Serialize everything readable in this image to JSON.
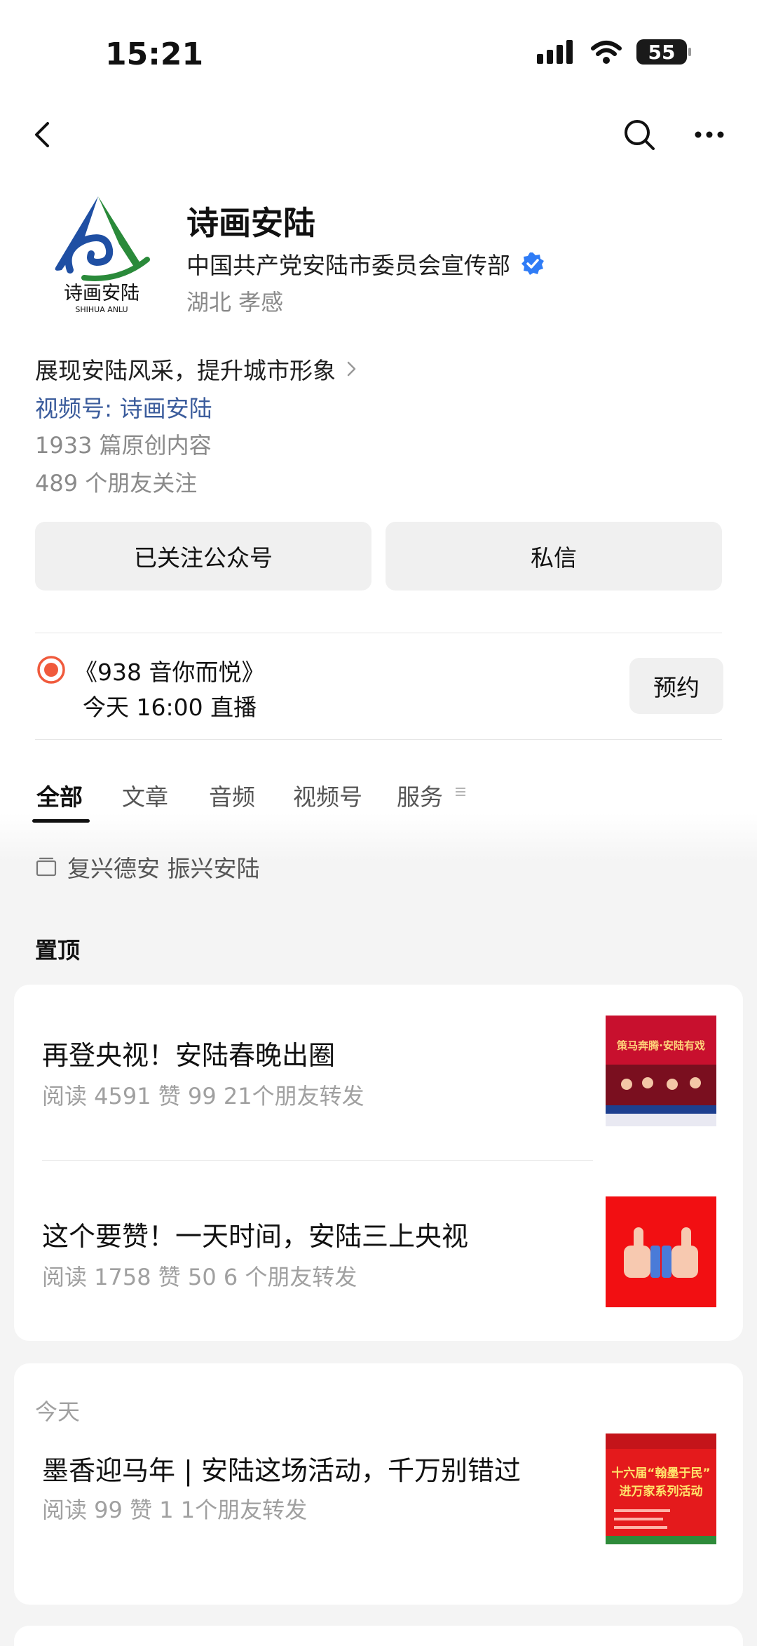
{
  "status": {
    "time": "15:21",
    "battery": "55"
  },
  "profile": {
    "name": "诗画安陆",
    "logo_text": "诗画安陆",
    "logo_subtext": "SHIHUA ANLU",
    "org": "中国共产党安陆市委员会宣传部",
    "location": "湖北 孝感",
    "description": "展现安陆风采，提升城市形象",
    "channel": "视频号: 诗画安陆",
    "original_count": "1933 篇原创内容",
    "friends_following": "489 个朋友关注"
  },
  "actions": {
    "follow": "已关注公众号",
    "message": "私信"
  },
  "live": {
    "title": "《938 音你而悦》",
    "time": "今天 16:00 直播",
    "reserve": "预约"
  },
  "tabs": [
    {
      "label": "全部"
    },
    {
      "label": "文章"
    },
    {
      "label": "音频"
    },
    {
      "label": "视频号"
    },
    {
      "label": "服务"
    }
  ],
  "tag": "复兴德安 振兴安陆",
  "pinned": {
    "label": "置顶",
    "items": [
      {
        "title": "再登央视！安陆春晚出圈",
        "meta": "阅读 4591   赞 99   21个朋友转发",
        "thumb_text": "策马奔腾·安陆有戏"
      },
      {
        "title": "这个要赞！一天时间，安陆三上央视",
        "meta": "阅读 1758   赞 50   6 个朋友转发"
      }
    ]
  },
  "today": {
    "label": "今天",
    "items": [
      {
        "title": "墨香迎马年 | 安陆这场活动，千万别错过",
        "meta": "阅读 99   赞 1   1个朋友转发",
        "thumb_lines": [
          "十六届“翰墨于民”",
          "进万家系列活动"
        ]
      }
    ]
  },
  "colors": {
    "accent_blue": "#3b5c9c",
    "live_red": "#f05a3c",
    "verified_blue": "#2f7cf6"
  }
}
